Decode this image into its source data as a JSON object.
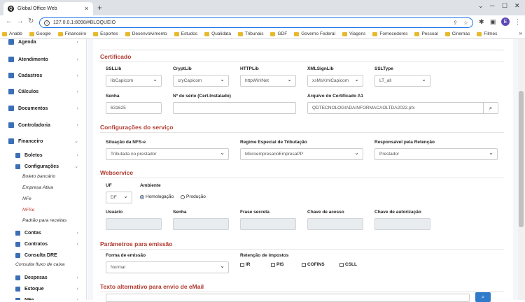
{
  "browser": {
    "tab_title": "Global Office Web",
    "tab_favicon_letter": "Q",
    "url": "127.0.0.1:8098/#BLOQUEIO",
    "avatar_letter": "E"
  },
  "bookmarks": [
    "Anabb",
    "Google",
    "Financeiro",
    "Esportes",
    "Desenvolvimento",
    "Estudos",
    "Qualidata",
    "Tribunais",
    "GDF",
    "Governo Federal",
    "Viagens",
    "Fornecedores",
    "Pessoal",
    "Cinemas",
    "Filmes"
  ],
  "sidebar": {
    "items": [
      {
        "label": "Agenda",
        "icon": "calendar-icon"
      },
      {
        "label": "Atendimento",
        "icon": "ticket-icon"
      },
      {
        "label": "Cadastros",
        "icon": "edit-icon"
      },
      {
        "label": "Cálculos",
        "icon": "calculator-icon"
      },
      {
        "label": "Documentos",
        "icon": "document-icon"
      },
      {
        "label": "Controladoria",
        "icon": "control-icon"
      },
      {
        "label": "Financeiro",
        "icon": "dollar-icon"
      }
    ],
    "sub_items": [
      {
        "label": "Boletos",
        "icon": "barcode-icon"
      },
      {
        "label": "Configurações",
        "icon": "gear-icon"
      }
    ],
    "leaves": [
      "Boleto bancário",
      "Empresa Ativa",
      "NFe",
      "NFSe",
      "Padrão para receitas"
    ],
    "sub_items2": [
      {
        "label": "Contas",
        "icon": "chart-icon"
      },
      {
        "label": "Contratos",
        "icon": "contract-icon"
      },
      {
        "label": "Consulta DRE",
        "icon": "report-icon"
      }
    ],
    "leaf2": "Consulta fluxo de caixa",
    "sub_items3": [
      {
        "label": "Despesas",
        "icon": "expense-icon"
      },
      {
        "label": "Estoque",
        "icon": "box-icon"
      },
      {
        "label": "NFe",
        "icon": "invoice-icon"
      }
    ]
  },
  "certificado": {
    "title": "Certificado",
    "ssllib": {
      "label": "SSLLib",
      "value": "libCapicom"
    },
    "cryptlib": {
      "label": "CryptLib",
      "value": "cryCapicom"
    },
    "httplib": {
      "label": "HTTPLib",
      "value": "httpWinINet"
    },
    "xmlsignlib": {
      "label": "XMLSignLib",
      "value": "xsMsXmlCapicom"
    },
    "ssltype": {
      "label": "SSLType",
      "value": "LT_all"
    },
    "senha": {
      "label": "Senha",
      "value": "631625"
    },
    "serie": {
      "label": "Nº de série (Cert.Instalado)",
      "value": ""
    },
    "arquivo": {
      "label": "Arquivo do Certificado A1",
      "value": "QDTECNOLOGIADAINFORMACAOLTDA2022.pfx"
    }
  },
  "servico": {
    "title": "Configurações do serviço",
    "situacao": {
      "label": "Situação da NFS-e",
      "value": "Tributada no prestador"
    },
    "regime": {
      "label": "Regime Especial de Tributação",
      "value": "MicroempresarioEmpresaPP"
    },
    "responsavel": {
      "label": "Responsável pela Retenção",
      "value": "Prestador"
    }
  },
  "webservice": {
    "title": "Webservice",
    "uf": {
      "label": "UF",
      "value": "DF"
    },
    "ambiente": {
      "label": "Ambiente",
      "opt1": "Homologação",
      "opt2": "Produção",
      "selected": "Homologação"
    },
    "usuario": "Usuário",
    "senha": "Senha",
    "frase": "Frase secreta",
    "chave_acesso": "Chave de acesso",
    "chave_autorizacao": "Chave de autorização"
  },
  "emissao": {
    "title": "Parâmetros para emissão",
    "forma": {
      "label": "Forma de emissão",
      "value": "Normal"
    },
    "retencao": {
      "label": "Retenção de impostos",
      "ir": "IR",
      "pis": "PIS",
      "cofins": "COFINS",
      "csll": "CSLL"
    }
  },
  "email": {
    "title": "Texto alternativo para envio de eMail"
  },
  "colors": {
    "accent": "#b0392f",
    "primary": "#2f7bc9"
  }
}
